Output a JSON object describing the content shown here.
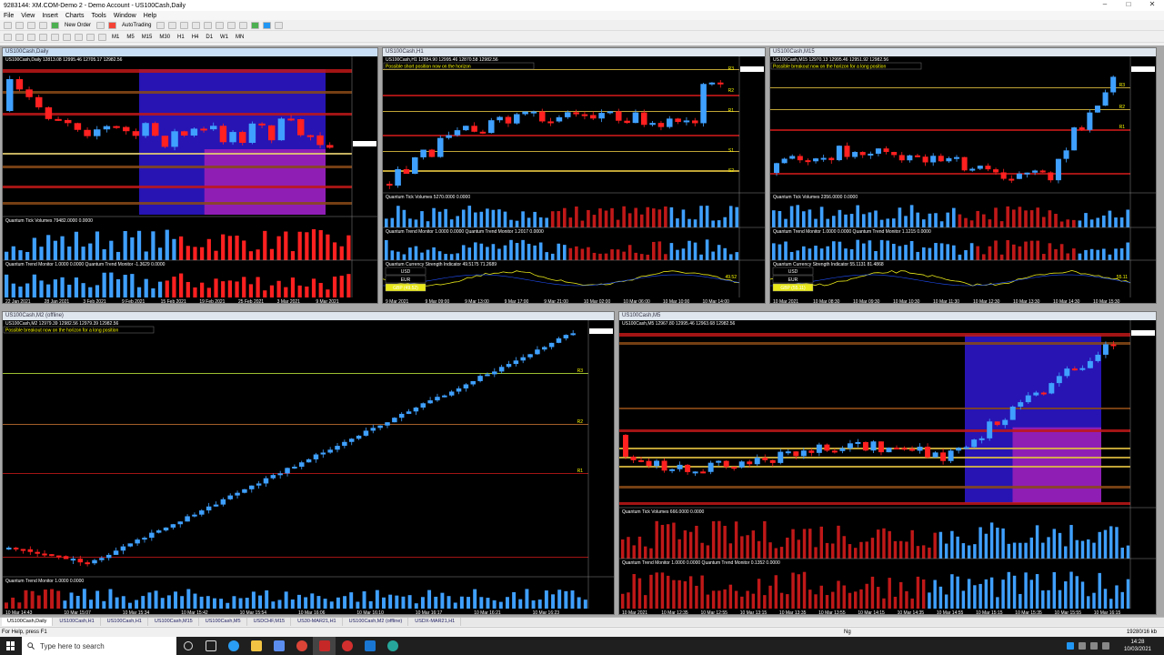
{
  "window": {
    "title": "9283144: XM.COM-Demo 2 - Demo Account - US100Cash,Daily"
  },
  "menu": [
    "File",
    "View",
    "Insert",
    "Charts",
    "Tools",
    "Window",
    "Help"
  ],
  "toolbar": {
    "new_order": "New Order",
    "autotrading": "AutoTrading"
  },
  "timeframes": [
    "M1",
    "M5",
    "M15",
    "M30",
    "H1",
    "H4",
    "D1",
    "W1",
    "MN"
  ],
  "charts": {
    "daily": {
      "caption": "US100Cash,Daily",
      "header": "US100Cash,Daily  12813.08 12995.46 12705.17 12982.56",
      "sub1": "Quantum Tick Volumes  79482.0000 0.0000",
      "sub2": "Quantum Trend Monitor 1.0000 0.0000  Quantum Trend Monitor -1.3629 0.0000",
      "dates": [
        "22 Jan 2021",
        "28 Jan 2021",
        "3 Feb 2021",
        "9 Feb 2021",
        "15 Feb 2021",
        "19 Feb 2021",
        "25 Feb 2021",
        "3 Mar 2021",
        "9 Mar 2021"
      ]
    },
    "h1": {
      "caption": "US100Cash,H1",
      "header": "US100Cash,H1  12884.90 12995.46 12870.58 12982.56",
      "alert": "Possible short position now on the horizon",
      "sub1": "Quantum Tick Volumes  5270.0000 0.0000",
      "sub2": "Quantum Trend Monitor 1.0000 0.0000  Quantum Trend Monitor 1.2017 0.0000",
      "sub3": "Quantum Currency Strength Indicator  49.5175 71.2689",
      "currencies": [
        "USD",
        "EUR",
        "GBP (49.52)"
      ],
      "value": "49.52",
      "dates": [
        "9 Mar 2021",
        "9 Mar 09:00",
        "9 Mar 13:00",
        "9 Mar 17:00",
        "9 Mar 21:00",
        "10 Mar 02:00",
        "10 Mar 06:00",
        "10 Mar 10:00",
        "10 Mar 14:00"
      ]
    },
    "m15": {
      "caption": "US100Cash,M15",
      "header": "US100Cash,M15  12970.13 12995.46 12951.92 12982.56",
      "alert": "Possible breakout now on the horizon for a long position",
      "sub1": "Quantum Tick Volumes  2356.0000 0.0000",
      "sub2": "Quantum Trend Monitor 1.0000 0.0000  Quantum Trend Monitor 1.1215 0.0000",
      "sub3": "Quantum Currency Strength Indicator  55.1131 81.4868",
      "currencies": [
        "USD",
        "EUR",
        "GBP (55.11)"
      ],
      "value": "55.11",
      "dates": [
        "10 Mar 2021",
        "10 Mar 08:30",
        "10 Mar 09:30",
        "10 Mar 10:30",
        "10 Mar 11:30",
        "10 Mar 12:30",
        "10 Mar 13:30",
        "10 Mar 14:30",
        "10 Mar 15:30"
      ]
    },
    "m2": {
      "caption": "US100Cash,M2 (offline)",
      "header": "US100Cash,M2  12979.39 12982.56 12979.39 12982.56",
      "alert": "Possible breakout now on the horizon for a long position",
      "sub1": "Quantum Trend Monitor 1.0000 0.0000",
      "dates": [
        "10 Mar 14:43",
        "10 Mar 15:07",
        "10 Mar 15:34",
        "10 Mar 15:42",
        "10 Mar 15:54",
        "10 Mar 16:06",
        "10 Mar 16:10",
        "10 Mar 16:17",
        "10 Mar 16:21",
        "10 Mar 16:23"
      ]
    },
    "m5": {
      "caption": "US100Cash,M5",
      "header": "US100Cash,M5  12967.80 12995.46 12963.68 12982.56",
      "sub1": "Quantum Tick Volumes  666.0000 0.0000",
      "sub2": "Quantum Trend Monitor 1.0000 0.0000  Quantum Trend Monitor 0.1352 0.0000",
      "dates": [
        "10 Mar 2021",
        "10 Mar 12:35",
        "10 Mar 12:55",
        "10 Mar 13:15",
        "10 Mar 13:35",
        "10 Mar 13:55",
        "10 Mar 14:15",
        "10 Mar 14:35",
        "10 Mar 14:55",
        "10 Mar 15:15",
        "10 Mar 15:35",
        "10 Mar 15:55",
        "10 Mar 16:15"
      ]
    }
  },
  "levels": {
    "r1": "R1",
    "r2": "R2",
    "r3": "R3",
    "s1": "S1",
    "s2": "S2"
  },
  "tabs": [
    "US100Cash,Daily",
    "US100Cash,H1",
    "US100Cash,H1",
    "US100Cash,M15",
    "US100Cash,M5",
    "USDCHF,M15",
    "US30-MAR21,H1",
    "US100Cash,M2 (offline)",
    "USDX-MAR21,H1"
  ],
  "status": {
    "help": "For Help, press F1",
    "profile": "Ng",
    "traffic": "19280/16 kb"
  },
  "taskbar": {
    "search_placeholder": "Type here to search",
    "time": "14:28",
    "date": "10/03/2021"
  }
}
